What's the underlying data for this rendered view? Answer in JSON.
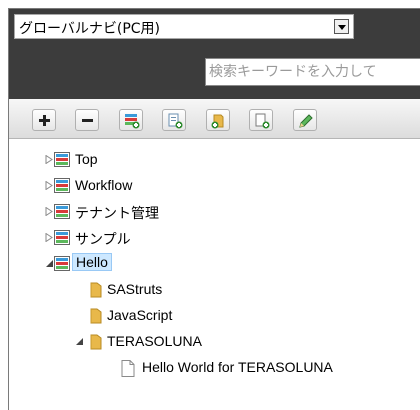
{
  "header": {
    "menu_select": {
      "value": "グローバルナビ(PC用)"
    },
    "search": {
      "placeholder": "検索キーワードを入力して"
    }
  },
  "toolbar": {
    "buttons": [
      {
        "icon": "plus-icon"
      },
      {
        "icon": "minus-icon"
      },
      {
        "icon": "add-list-icon"
      },
      {
        "icon": "add-page-icon"
      },
      {
        "icon": "add-folder-icon"
      },
      {
        "icon": "new-document-icon"
      },
      {
        "icon": "edit-pencil-icon"
      }
    ]
  },
  "tree": {
    "nodes": [
      {
        "label": "Top",
        "type": "list",
        "expanded": false
      },
      {
        "label": "Workflow",
        "type": "list",
        "expanded": false
      },
      {
        "label": "テナント管理",
        "type": "list",
        "expanded": false
      },
      {
        "label": "サンプル",
        "type": "list",
        "expanded": false
      },
      {
        "label": "Hello",
        "type": "list",
        "expanded": true,
        "selected": true
      },
      {
        "label": "SAStruts",
        "type": "folder"
      },
      {
        "label": "JavaScript",
        "type": "folder"
      },
      {
        "label": "TERASOLUNA",
        "type": "folder",
        "expanded": true
      },
      {
        "label": "Hello World for TERASOLUNA",
        "type": "page"
      }
    ]
  },
  "colors": {
    "header_bg": "#3c3c3c",
    "selection_bg": "#cde8ff",
    "folder": "#e8b84a"
  }
}
